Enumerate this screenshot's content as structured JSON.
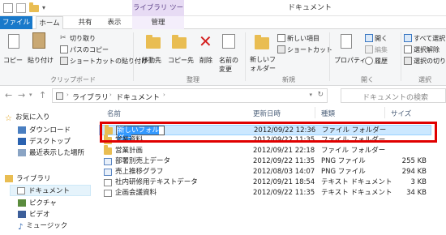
{
  "titlebar": {
    "library_tools": "ライブラリ ツール",
    "window_title": "ドキュメント"
  },
  "tabs": {
    "file": "ファイル",
    "home": "ホーム",
    "share": "共有",
    "view": "表示",
    "manage": "管理"
  },
  "ribbon": {
    "clipboard": {
      "copy": "コピー",
      "paste": "貼り付け",
      "cut": "切り取り",
      "copy_path": "パスのコピー",
      "paste_shortcut": "ショートカットの貼り付け",
      "label": "クリップボード"
    },
    "organize": {
      "move_to": "移動先",
      "copy_to": "コピー先",
      "delete": "削除",
      "rename": "名前の変更",
      "label": "整理"
    },
    "new": {
      "new_folder": "新しいフォルダー",
      "new_item": "新しい項目",
      "shortcut": "ショートカット",
      "label": "新規"
    },
    "open": {
      "properties": "プロパティ",
      "open": "開く",
      "edit": "編集",
      "history": "履歴",
      "label": "開く"
    },
    "select": {
      "select_all": "すべて選択",
      "select_none": "選択解除",
      "invert": "選択の切り",
      "label": "選択"
    }
  },
  "address": {
    "path_root": "ライブラリ",
    "path_leaf": "ドキュメント",
    "search_placeholder": "ドキュメントの検索"
  },
  "nav": {
    "favorites": "お気に入り",
    "downloads": "ダウンロード",
    "desktop": "デスクトップ",
    "recent": "最近表示した場所",
    "libraries": "ライブラリ",
    "documents": "ドキュメント",
    "pictures": "ピクチャ",
    "videos": "ビデオ",
    "music": "ミュージック"
  },
  "columns": {
    "name": "名前",
    "modified": "更新日時",
    "type": "種類",
    "size": "サイズ"
  },
  "files": [
    {
      "name": "新しいフォルダー",
      "date": "2012/09/22 12:36",
      "type": "ファイル フォルダー",
      "size": "",
      "icon": "folder-icon"
    },
    {
      "name": "営業資料",
      "date": "2012/09/22 11:35",
      "type": "ファイル フォルダー",
      "size": "",
      "icon": "folder-icon"
    },
    {
      "name": "営業計画",
      "date": "2012/09/21 22:18",
      "type": "ファイル フォルダー",
      "size": "",
      "icon": "folder-icon"
    },
    {
      "name": "部署別売上データ",
      "date": "2012/09/22 11:35",
      "type": "PNG ファイル",
      "size": "255 KB",
      "icon": "image-icon"
    },
    {
      "name": "売上推移グラフ",
      "date": "2012/08/03 14:07",
      "type": "PNG ファイル",
      "size": "294 KB",
      "icon": "image-icon"
    },
    {
      "name": "社内研修用テキストデータ",
      "date": "2012/09/21 18:54",
      "type": "テキスト ドキュメント",
      "size": "3 KB",
      "icon": "text-file-icon"
    },
    {
      "name": "企画会議資料",
      "date": "2012/09/22 11:35",
      "type": "テキスト ドキュメント",
      "size": "34 KB",
      "icon": "text-file-icon"
    }
  ],
  "colors": {
    "file_tab": "#1979ca",
    "selection": "#cce8ff",
    "highlight": "#e00000",
    "folder": "#e9bd52"
  }
}
